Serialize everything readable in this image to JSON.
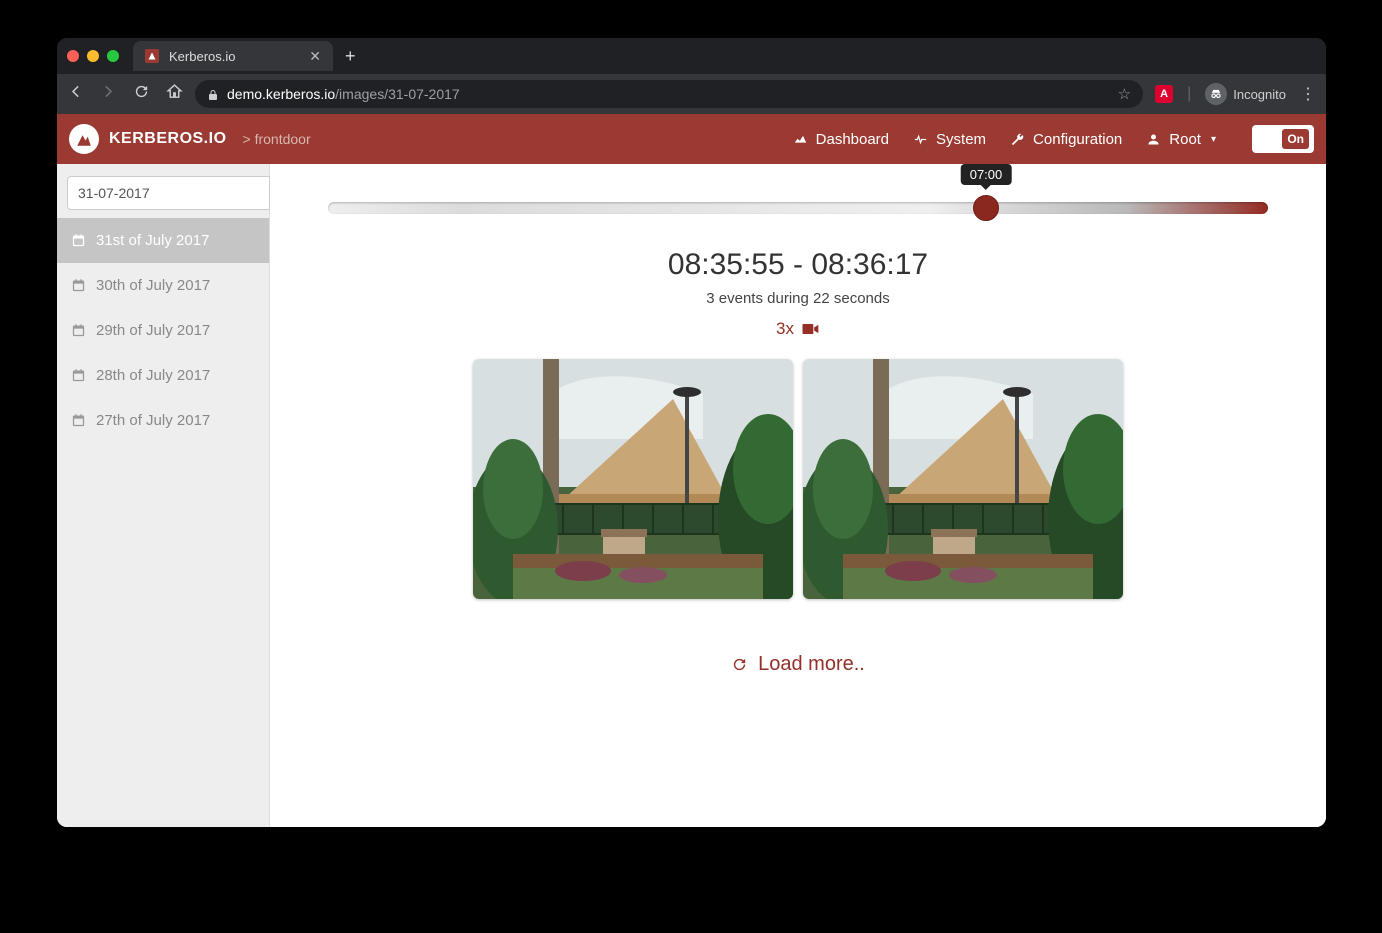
{
  "browser": {
    "tab_title": "Kerberos.io",
    "url_host": "demo.kerberos.io",
    "url_path": "/images/31-07-2017",
    "incognito_label": "Incognito"
  },
  "app": {
    "brand": "KERBEROS.IO",
    "breadcrumb_prefix": ">",
    "breadcrumb": "frontdoor",
    "nav": {
      "dashboard": "Dashboard",
      "system": "System",
      "configuration": "Configuration",
      "user": "Root"
    },
    "toggle_label": "On"
  },
  "sidebar": {
    "date_value": "31-07-2017",
    "dates": [
      "31st of July 2017",
      "30th of July 2017",
      "29th of July 2017",
      "28th of July 2017",
      "27th of July 2017"
    ]
  },
  "timeline": {
    "handle_percent": 70,
    "tooltip": "07:00"
  },
  "group": {
    "title": "08:35:55 - 08:36:17",
    "subtitle": "3 events during 22 seconds",
    "video_count_label": "3x"
  },
  "load_more_label": "Load more.."
}
